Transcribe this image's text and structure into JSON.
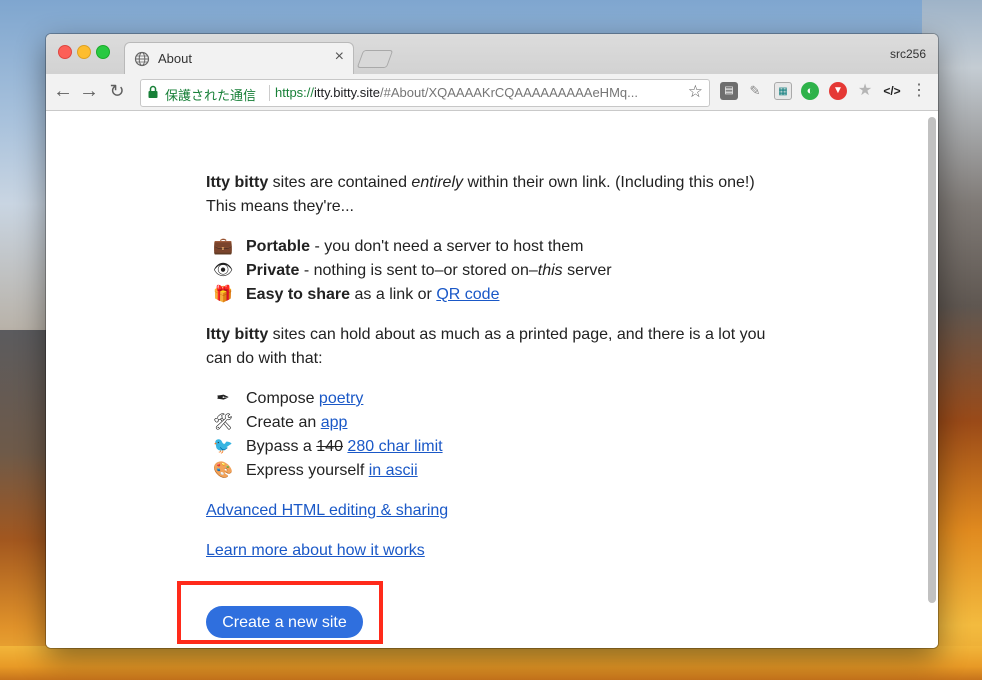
{
  "browser": {
    "tab_title": "About",
    "profile_name": "src256",
    "security_label": "保護された通信",
    "url_scheme": "https://",
    "url_host": "itty.bitty.site",
    "url_path": "/#About/XQAAAAKrCQAAAAAAAAAeHMq..."
  },
  "page": {
    "intro_bold": "Itty bitty",
    "intro_a": " sites are contained ",
    "intro_em": "entirely",
    "intro_b": " within their own link. (Including this one!) This means they're...",
    "features": [
      {
        "icon": "briefcase-icon",
        "glyph": "💼",
        "bold": "Portable",
        "text": " - you don't need a server to host them"
      },
      {
        "icon": "eye-icon",
        "glyph": "👁",
        "bold": "Private",
        "text": " - nothing is sent to–or stored on–",
        "em": "this",
        "tail": " server"
      },
      {
        "icon": "gift-icon",
        "glyph": "🎁",
        "bold": "Easy to share",
        "text": " as a link or ",
        "link": "QR code"
      }
    ],
    "second_bold": "Itty bitty",
    "second_text": " sites can hold about as much as a printed page, and there is a lot you can do with that:",
    "uses": [
      {
        "icon": "quill-icon",
        "glyph": "✒",
        "text": "Compose ",
        "link": "poetry"
      },
      {
        "icon": "tools-icon",
        "glyph": "🛠",
        "text": "Create an ",
        "link": "app"
      },
      {
        "icon": "bird-icon",
        "glyph": "🐦",
        "text": "Bypass a ",
        "strike": "140",
        "link": "280 char limit"
      },
      {
        "icon": "palette-icon",
        "glyph": "🎨",
        "text": "Express yourself ",
        "link": "in ascii"
      }
    ],
    "advanced_link": "Advanced HTML editing & sharing",
    "learn_link": "Learn more about how it works",
    "create_button": "Create a new site"
  },
  "colors": {
    "link": "#1a58c7",
    "button": "#2f6fde",
    "highlight_box": "#ff2a1a",
    "secure_green": "#188038"
  }
}
